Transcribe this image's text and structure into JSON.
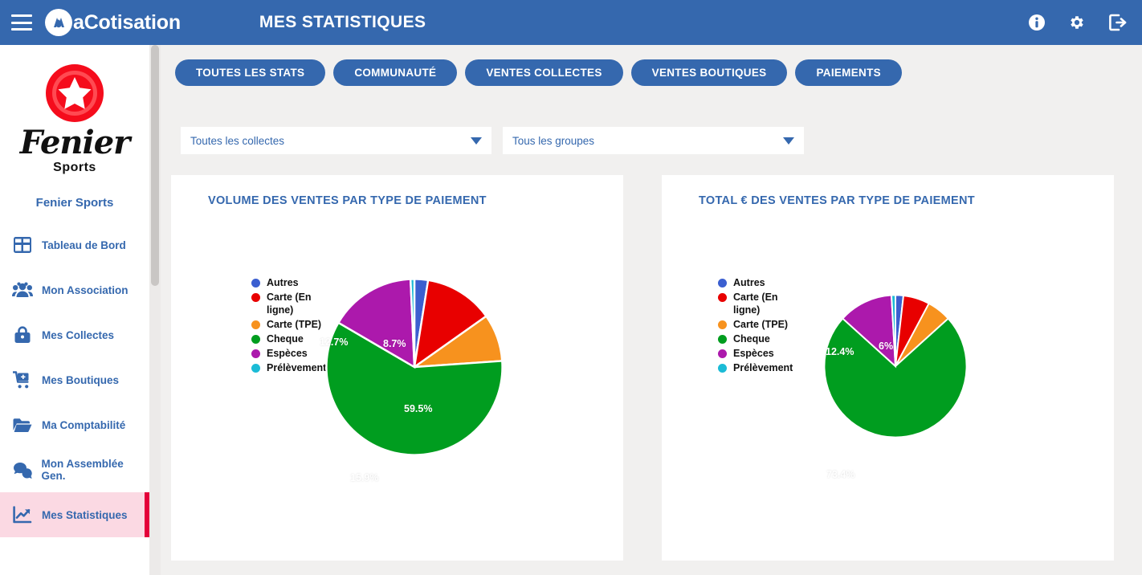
{
  "topbar": {
    "menu_icon": "hamburger-icon",
    "brand": "aCotisation",
    "brand_badge_icon": "macotisation-logo-icon",
    "title": "MES STATISTIQUES",
    "icons": [
      {
        "name": "info-icon",
        "label": "Informations"
      },
      {
        "name": "gear-icon",
        "label": "Paramètres"
      },
      {
        "name": "logout-icon",
        "label": "Déconnexion"
      }
    ]
  },
  "sidebar": {
    "logo_icon": "fenier-sports-star-badge-icon",
    "logo_name": "Fenier",
    "logo_sub": "Sports",
    "org_name": "Fenier Sports",
    "items": [
      {
        "label": "Tableau de Bord",
        "icon": "dashboard-grid-icon",
        "active": false
      },
      {
        "label": "Mon Association",
        "icon": "people-group-icon",
        "active": false
      },
      {
        "label": "Mes Collectes",
        "icon": "bag-icon",
        "active": false
      },
      {
        "label": "Mes Boutiques",
        "icon": "shopping-cart-icon",
        "active": false
      },
      {
        "label": "Ma Comptabilité",
        "icon": "folder-icon",
        "active": false
      },
      {
        "label": "Mon Assemblée Gen.",
        "icon": "speech-bubbles-icon",
        "active": false
      },
      {
        "label": "Mes Statistiques",
        "icon": "chart-line-icon",
        "active": true
      }
    ]
  },
  "tabs": [
    {
      "label": "TOUTES LES STATS"
    },
    {
      "label": "COMMUNAUTÉ"
    },
    {
      "label": "VENTES COLLECTES"
    },
    {
      "label": "VENTES BOUTIQUES"
    },
    {
      "label": "PAIEMENTS"
    }
  ],
  "filters": [
    {
      "name": "collectes-select",
      "value": "Toutes les collectes",
      "caret_icon": "chevron-down-icon"
    },
    {
      "name": "groupes-select",
      "value": "Tous les groupes",
      "caret_icon": "chevron-down-icon"
    }
  ],
  "colors": {
    "brand_blue": "#3568ae",
    "page_bg": "#f1f0ef",
    "active_nav_bg": "#fbd9e3",
    "active_nav_accent": "#e4003a",
    "autres": "#3b5fd0",
    "carte_en_ligne": "#e80000",
    "carte_tpe": "#f7921e",
    "cheque": "#009d1f",
    "especes": "#ac19ac",
    "prelevement": "#1bbbd6"
  },
  "chart_data": [
    {
      "type": "pie",
      "title": "VOLUME DES VENTES PAR TYPE DE PAIEMENT",
      "legend_position": "left",
      "categories": [
        "Autres",
        "Carte (En ligne)",
        "Carte (TPE)",
        "Cheque",
        "Espèces",
        "Prélèvement"
      ],
      "values": [
        2.5,
        12.7,
        8.7,
        59.5,
        15.9,
        0.7
      ],
      "colors": [
        "#3b5fd0",
        "#e80000",
        "#f7921e",
        "#009d1f",
        "#ac19ac",
        "#1bbbd6"
      ],
      "labels_shown": [
        {
          "category": "Carte (En ligne)",
          "text": "12.7%"
        },
        {
          "category": "Carte (TPE)",
          "text": "8.7%"
        },
        {
          "category": "Cheque",
          "text": "59.5%"
        },
        {
          "category": "Espèces",
          "text": "15.9%"
        }
      ]
    },
    {
      "type": "pie",
      "title": "TOTAL € DES VENTES PAR TYPE DE PAIEMENT",
      "legend_position": "left",
      "categories": [
        "Autres",
        "Carte (En ligne)",
        "Carte (TPE)",
        "Cheque",
        "Espèces",
        "Prélèvement"
      ],
      "values": [
        1.8,
        6.0,
        5.5,
        73.4,
        12.4,
        0.9
      ],
      "colors": [
        "#3b5fd0",
        "#e80000",
        "#f7921e",
        "#009d1f",
        "#ac19ac",
        "#1bbbd6"
      ],
      "labels_shown": [
        {
          "category": "Carte (En ligne)",
          "text": "6%"
        },
        {
          "category": "Cheque",
          "text": "73.4%"
        },
        {
          "category": "Espèces",
          "text": "12.4%"
        }
      ]
    }
  ]
}
